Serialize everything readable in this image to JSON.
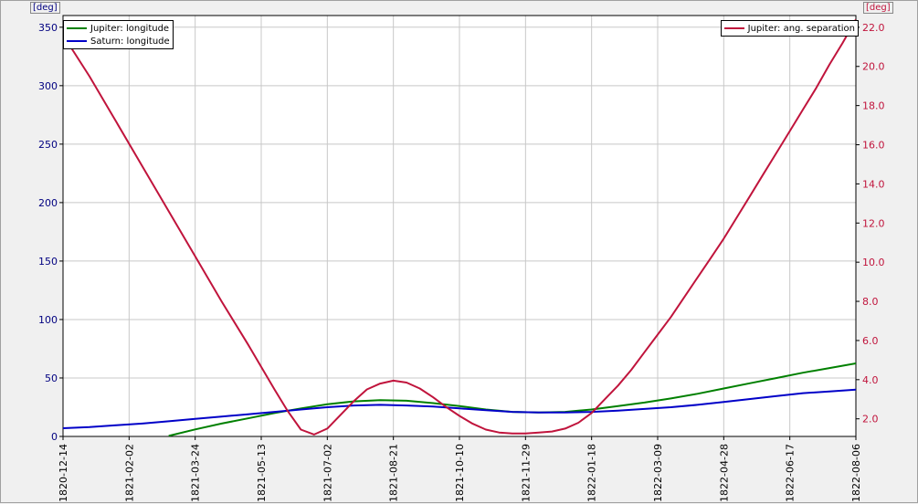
{
  "chart_data": {
    "type": "line",
    "left_axis": {
      "unit": "[deg]",
      "ylim": [
        0,
        360
      ],
      "ticks": [
        0,
        50,
        100,
        150,
        200,
        250,
        300,
        350
      ],
      "color": "#000080"
    },
    "right_axis": {
      "unit": "[deg]",
      "ylim": [
        1.1,
        22.6
      ],
      "ticks": [
        "2.0",
        "4.0",
        "6.0",
        "8.0",
        "10.0",
        "12.0",
        "14.0",
        "16.0",
        "18.0",
        "20.0",
        "22.0"
      ],
      "color": "#c0143c"
    },
    "x_ticks": [
      "1820-12-14",
      "1821-02-02",
      "1821-03-24",
      "1821-05-13",
      "1821-07-02",
      "1821-08-21",
      "1821-10-10",
      "1821-11-29",
      "1822-01-18",
      "1822-03-09",
      "1822-04-28",
      "1822-06-17",
      "1822-08-06"
    ],
    "grid": true,
    "series": [
      {
        "name": "Jupiter: longitude",
        "axis": "left",
        "color": "#008000",
        "x": [
          "1821-03-04",
          "1821-03-24",
          "1821-04-13",
          "1821-05-03",
          "1821-05-23",
          "1821-06-12",
          "1821-07-02",
          "1821-07-22",
          "1821-08-11",
          "1821-08-31",
          "1821-09-20",
          "1821-10-10",
          "1821-10-30",
          "1821-11-19",
          "1821-12-09",
          "1821-12-29",
          "1822-01-18",
          "1822-02-07",
          "1822-02-27",
          "1822-03-19",
          "1822-04-08",
          "1822-04-28",
          "1822-05-18",
          "1822-06-07",
          "1822-06-27",
          "1822-07-17",
          "1822-08-06"
        ],
        "y": [
          0.5,
          6,
          11,
          15.5,
          20,
          24,
          27.5,
          30,
          31,
          30.5,
          28.5,
          26,
          23,
          21,
          20.5,
          21,
          23,
          26,
          29,
          32.5,
          36.5,
          41,
          45.5,
          50,
          54.5,
          58.5,
          62.5
        ]
      },
      {
        "name": "Saturn: longitude",
        "axis": "left",
        "color": "#0000c8",
        "x": [
          "1820-12-14",
          "1821-01-03",
          "1821-01-23",
          "1821-02-12",
          "1821-03-04",
          "1821-03-24",
          "1821-04-13",
          "1821-05-03",
          "1821-05-23",
          "1821-06-12",
          "1821-07-02",
          "1821-07-22",
          "1821-08-11",
          "1821-08-31",
          "1821-09-20",
          "1821-10-10",
          "1821-10-30",
          "1821-11-19",
          "1821-12-09",
          "1821-12-29",
          "1822-01-18",
          "1822-02-07",
          "1822-02-27",
          "1822-03-19",
          "1822-04-08",
          "1822-04-28",
          "1822-05-18",
          "1822-06-07",
          "1822-06-27",
          "1822-07-17",
          "1822-08-06"
        ],
        "y": [
          7,
          8,
          9.5,
          11,
          13,
          15,
          17,
          19,
          21,
          23,
          25,
          26.5,
          27,
          26.5,
          25.5,
          24,
          22.5,
          21,
          20.5,
          20.5,
          21,
          22,
          23.5,
          25,
          27,
          29.5,
          32,
          34.5,
          37,
          38.5,
          40
        ]
      },
      {
        "name": "Jupiter: ang. separation",
        "axis": "right",
        "color": "#c0143c",
        "x": [
          "1820-12-14",
          "1821-01-03",
          "1821-01-23",
          "1821-02-12",
          "1821-03-04",
          "1821-03-24",
          "1821-04-13",
          "1821-05-03",
          "1821-05-23",
          "1821-06-02",
          "1821-06-12",
          "1821-06-22",
          "1821-07-02",
          "1821-07-12",
          "1821-07-22",
          "1821-08-01",
          "1821-08-11",
          "1821-08-21",
          "1821-08-31",
          "1821-09-10",
          "1821-09-20",
          "1821-09-30",
          "1821-10-10",
          "1821-10-20",
          "1821-10-30",
          "1821-11-09",
          "1821-11-19",
          "1821-11-29",
          "1821-12-09",
          "1821-12-19",
          "1821-12-29",
          "1822-01-08",
          "1822-01-18",
          "1822-01-28",
          "1822-02-07",
          "1822-02-17",
          "1822-02-27",
          "1822-03-09",
          "1822-03-19",
          "1822-03-29",
          "1822-04-08",
          "1822-04-18",
          "1822-04-28",
          "1822-05-08",
          "1822-05-18",
          "1822-05-28",
          "1822-06-07",
          "1822-06-17",
          "1822-06-27",
          "1822-07-07",
          "1822-07-17",
          "1822-07-27",
          "1822-08-06"
        ],
        "y": [
          21.6,
          19.5,
          17.2,
          14.9,
          12.6,
          10.3,
          8.0,
          5.8,
          3.5,
          2.4,
          1.45,
          1.2,
          1.5,
          2.2,
          2.9,
          3.5,
          3.8,
          3.95,
          3.85,
          3.55,
          3.1,
          2.6,
          2.15,
          1.75,
          1.45,
          1.3,
          1.25,
          1.25,
          1.3,
          1.35,
          1.5,
          1.8,
          2.3,
          3.0,
          3.7,
          4.5,
          5.4,
          6.3,
          7.2,
          8.2,
          9.2,
          10.2,
          11.2,
          12.3,
          13.4,
          14.5,
          15.6,
          16.7,
          17.8,
          18.9,
          20.1,
          21.2,
          22.4
        ]
      }
    ]
  }
}
